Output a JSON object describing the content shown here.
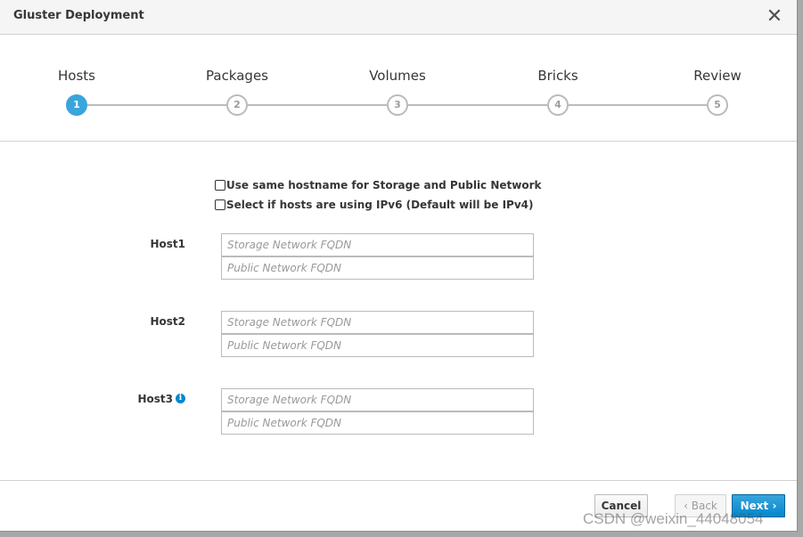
{
  "dialog": {
    "title": "Gluster Deployment",
    "close_glyph": "✕"
  },
  "wizard": {
    "steps": [
      {
        "label": "Hosts",
        "number": "1",
        "active": true
      },
      {
        "label": "Packages",
        "number": "2",
        "active": false
      },
      {
        "label": "Volumes",
        "number": "3",
        "active": false
      },
      {
        "label": "Bricks",
        "number": "4",
        "active": false
      },
      {
        "label": "Review",
        "number": "5",
        "active": false
      }
    ]
  },
  "options": {
    "same_hostname_label": "Use same hostname for Storage and Public Network",
    "ipv6_label": "Select if hosts are using IPv6 (Default will be IPv4)"
  },
  "hosts": [
    {
      "label": "Host1",
      "storage_placeholder": "Storage Network FQDN",
      "public_placeholder": "Public Network FQDN"
    },
    {
      "label": "Host2",
      "storage_placeholder": "Storage Network FQDN",
      "public_placeholder": "Public Network FQDN"
    },
    {
      "label": "Host3",
      "storage_placeholder": "Storage Network FQDN",
      "public_placeholder": "Public Network FQDN"
    }
  ],
  "info_icon_glyph": "i",
  "footer": {
    "cancel_label": "Cancel",
    "back_label": "‹ Back",
    "next_label": "Next ›"
  },
  "watermark": "CSDN @weixin_44048054",
  "colors": {
    "accent": "#39a5dc",
    "primary_button": "#0088ce"
  }
}
